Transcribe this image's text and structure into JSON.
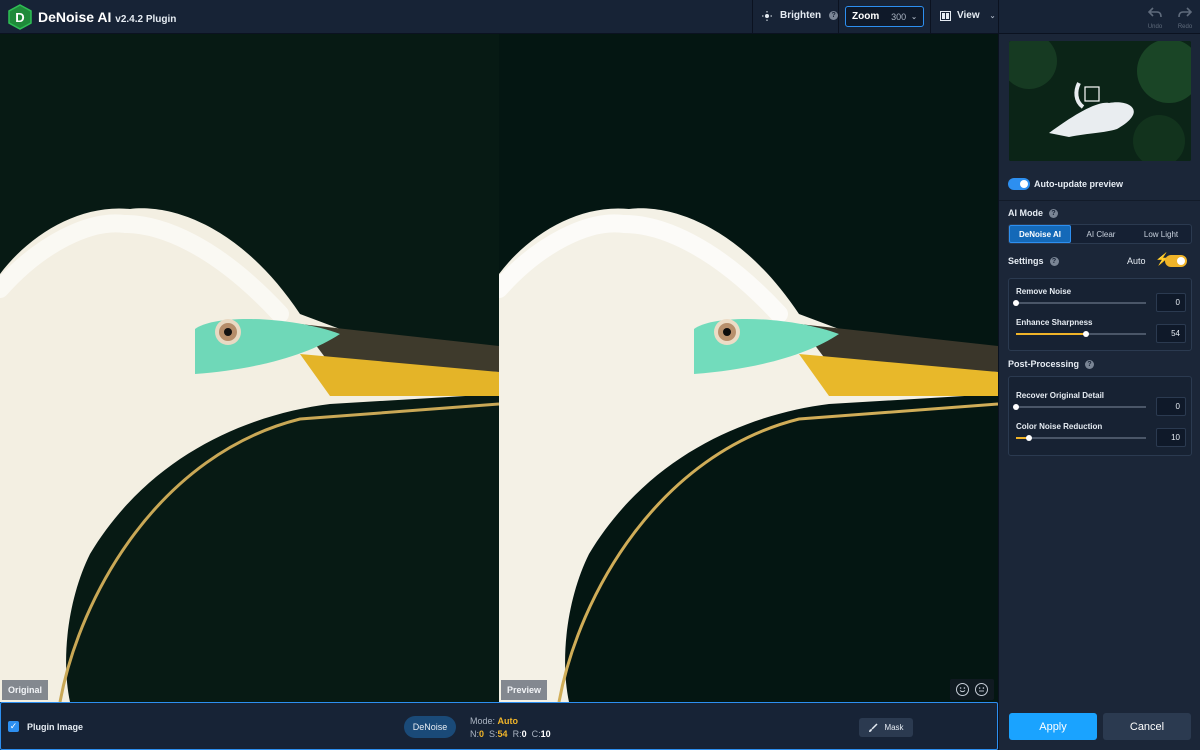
{
  "header": {
    "app_name": "DeNoise AI",
    "version": "v2.4.2 Plugin",
    "brighten_label": "Brighten",
    "zoom_label": "Zoom",
    "zoom_value": "300",
    "view_label": "View",
    "undo_label": "Undo",
    "redo_label": "Redo"
  },
  "viewer": {
    "left_label": "Original",
    "right_label": "Preview"
  },
  "sidebar": {
    "auto_update_label": "Auto-update preview",
    "auto_update_on": true,
    "ai_mode_title": "AI Mode",
    "ai_modes": [
      {
        "label": "DeNoise AI",
        "active": true
      },
      {
        "label": "AI Clear",
        "active": false
      },
      {
        "label": "Low Light",
        "active": false
      }
    ],
    "settings_title": "Settings",
    "auto_label": "Auto",
    "settings_sliders": [
      {
        "label": "Remove Noise",
        "value": "0",
        "fraction": 0.0
      },
      {
        "label": "Enhance Sharpness",
        "value": "54",
        "fraction": 0.54
      }
    ],
    "post_title": "Post-Processing",
    "post_sliders": [
      {
        "label": "Recover Original Detail",
        "value": "0",
        "fraction": 0.0
      },
      {
        "label": "Color Noise Reduction",
        "value": "10",
        "fraction": 0.1
      }
    ],
    "apply_label": "Apply",
    "cancel_label": "Cancel"
  },
  "bottom": {
    "plugin_label": "Plugin Image",
    "plugin_checked": true,
    "denoise_label": "DeNoise",
    "mode_prefix": "Mode:",
    "mode_value": "Auto",
    "n_label": "N:",
    "n_value": "0",
    "s_label": "S:",
    "s_value": "54",
    "r_label": "R:",
    "r_value": "0",
    "c_label": "C:",
    "c_value": "10",
    "mask_label": "Mask"
  },
  "colors": {
    "accent": "#2d8ff0",
    "gold": "#f0b429",
    "apply": "#1aa3ff"
  }
}
